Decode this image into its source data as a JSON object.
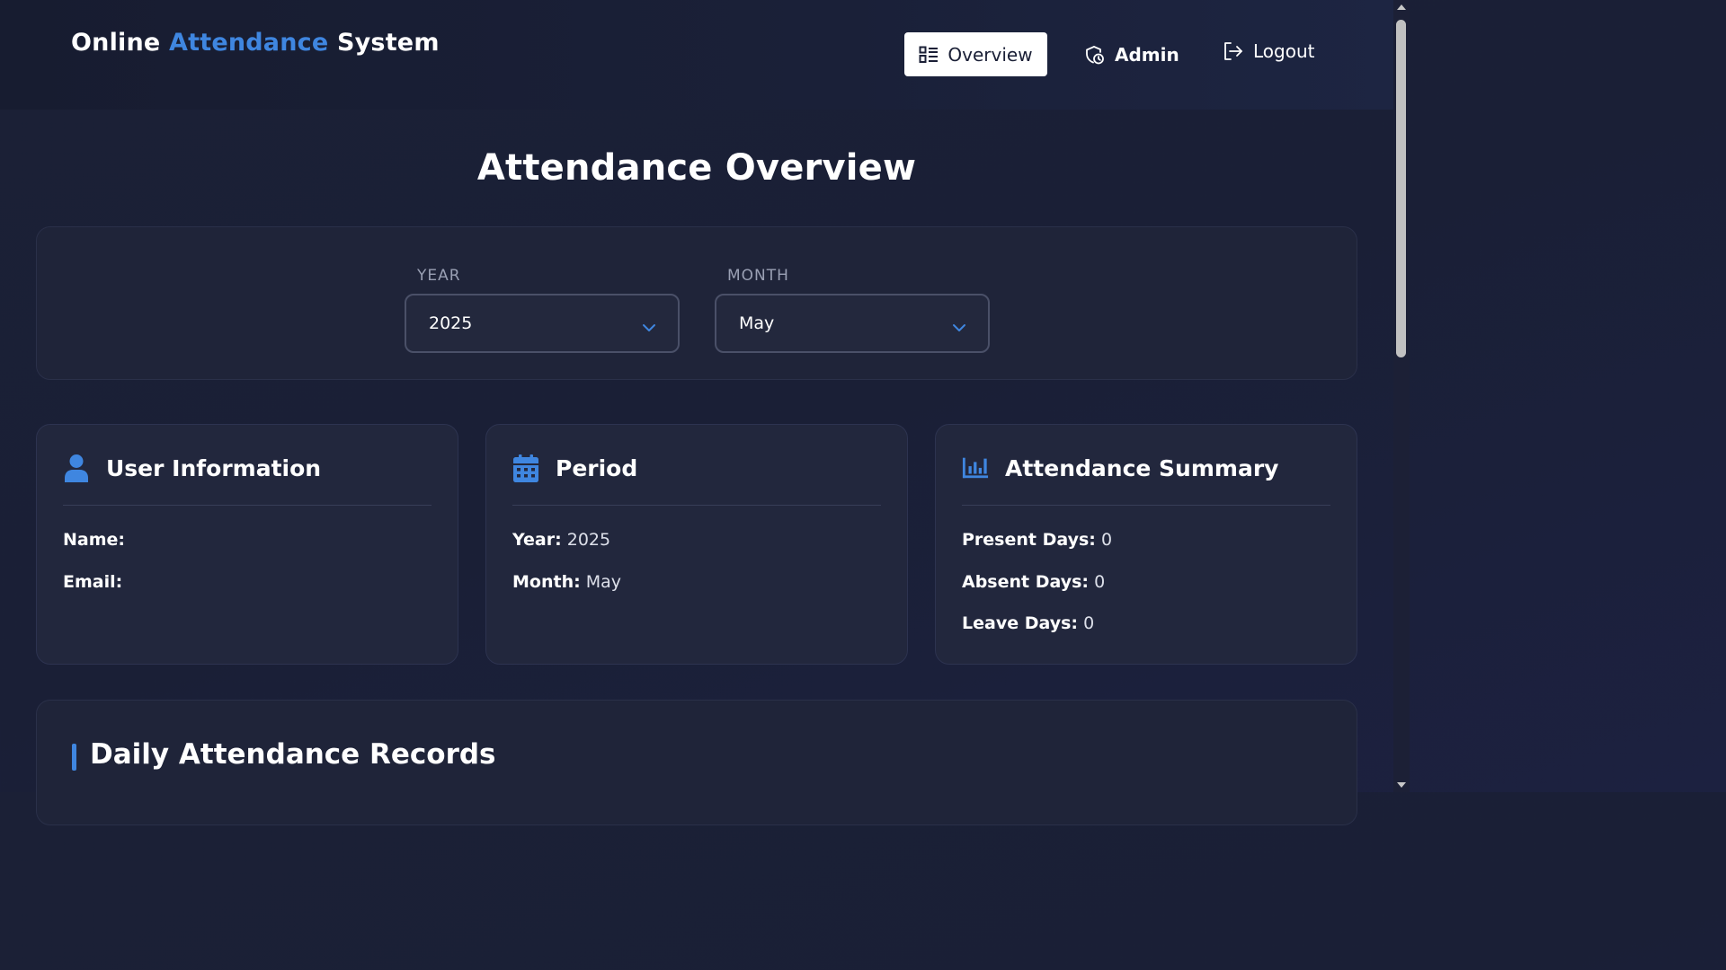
{
  "header": {
    "brand_part1": "Online",
    "brand_part2": "Attendance",
    "brand_part3": "System",
    "nav": {
      "overview": "Overview",
      "admin": "Admin",
      "logout": "Logout"
    }
  },
  "page_title": "Attendance Overview",
  "filters": {
    "year_label": "YEAR",
    "year_value": "2025",
    "month_label": "MONTH",
    "month_value": "May"
  },
  "cards": {
    "user": {
      "title": "User Information",
      "name_label": "Name:",
      "name_value": "",
      "email_label": "Email:",
      "email_value": ""
    },
    "period": {
      "title": "Period",
      "year_label": "Year:",
      "year_value": "2025",
      "month_label": "Month:",
      "month_value": "May"
    },
    "summary": {
      "title": "Attendance Summary",
      "present_label": "Present Days:",
      "present_value": "0",
      "absent_label": "Absent Days:",
      "absent_value": "0",
      "leave_label": "Leave Days:",
      "leave_value": "0"
    }
  },
  "records": {
    "title": "Daily Attendance Records"
  },
  "colors": {
    "accent": "#3f86e0",
    "background": "#1a1f36",
    "card": "#22273d"
  },
  "icons": {
    "overview": "list-grid-icon",
    "admin": "shield-clock-icon",
    "logout": "logout-icon",
    "user": "user-icon",
    "period": "calendar-icon",
    "summary": "bar-chart-icon",
    "select": "chevron-down-icon"
  }
}
